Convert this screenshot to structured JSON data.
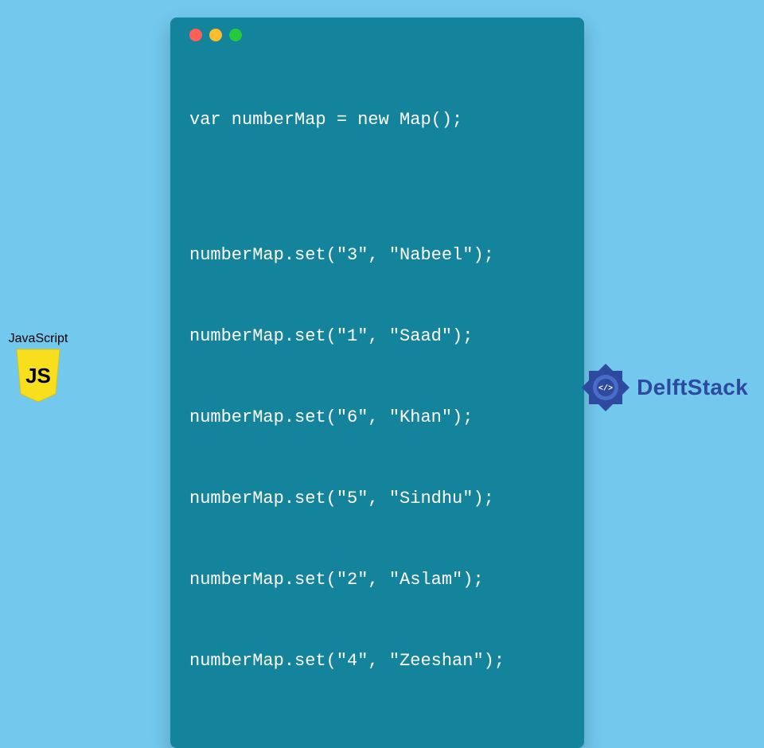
{
  "code": {
    "lines": [
      "var numberMap = new Map();",
      "",
      "numberMap.set(\"3\", \"Nabeel\");",
      "numberMap.set(\"1\", \"Saad\");",
      "numberMap.set(\"6\", \"Khan\");",
      "numberMap.set(\"5\", \"Sindhu\");",
      "numberMap.set(\"2\", \"Aslam\");",
      "numberMap.set(\"4\", \"Zeeshan\");"
    ]
  },
  "js_badge": {
    "label": "JavaScript",
    "shield_text": "JS"
  },
  "brand": {
    "name": "DelftStack"
  },
  "colors": {
    "page_bg": "#72c8ed",
    "window_bg": "#14849c",
    "js_yellow": "#f7df1e",
    "brand_blue": "#2d4a9e"
  }
}
